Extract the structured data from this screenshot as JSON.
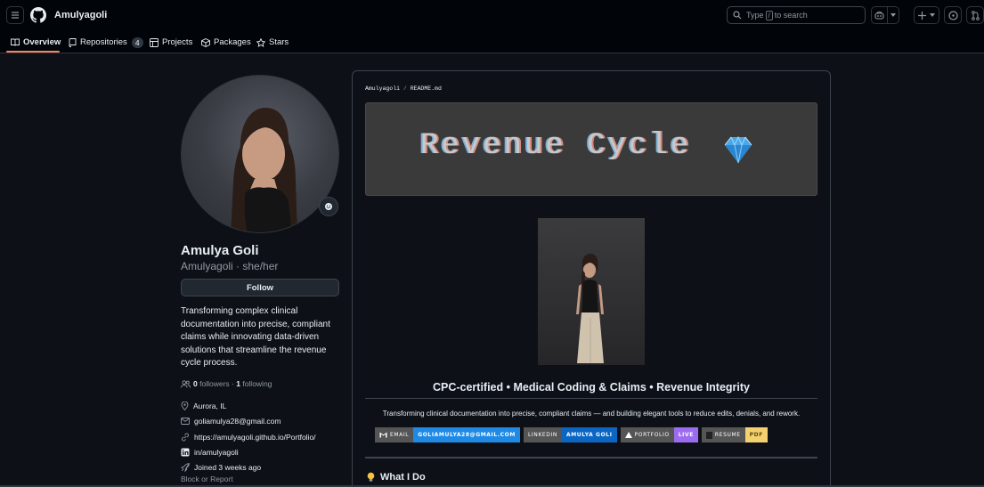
{
  "header": {
    "owner": "Amulyagoli",
    "search_prefix": "Type",
    "search_key": "/",
    "search_suffix": "to search"
  },
  "tabs": [
    {
      "label": "Overview"
    },
    {
      "label": "Repositories",
      "count": "4"
    },
    {
      "label": "Projects"
    },
    {
      "label": "Packages"
    },
    {
      "label": "Stars"
    }
  ],
  "profile": {
    "name": "Amulya Goli",
    "login_pronouns": "Amulyagoli · she/her",
    "follow_label": "Follow",
    "bio": "Transforming complex clinical documentation into precise, compliant claims while innovating data-driven solutions that streamline the revenue cycle process.",
    "followers_count": "0",
    "followers_label": "followers",
    "following_count": "1",
    "following_label": "following",
    "location": "Aurora, IL",
    "email": "goliamulya28@gmail.com",
    "website": "https://amulyagoli.github.io/Portfolio/",
    "linkedin": "in/amulyagoli",
    "joined": "Joined 3 weeks ago",
    "block_report": "Block or Report"
  },
  "readme": {
    "crumb_owner": "Amulyagoli",
    "crumb_file": "README.md",
    "banner_text": "Revenue Cycle",
    "heading": "CPC-certified • Medical Coding & Claims • Revenue Integrity",
    "tagline": "Transforming clinical documentation into precise, compliant claims — and building elegant tools to reduce edits, denials, and rework.",
    "badges": [
      {
        "key": "EMAIL",
        "value": "GOLIAMULYA28@GMAIL.COM",
        "color": "#1f8ae6"
      },
      {
        "key": "LINKEDIN",
        "value": "AMULYA GOLI",
        "color": "#0a66c2"
      },
      {
        "key": "PORTFOLIO",
        "value": "LIVE",
        "color": "#9b6cf0"
      },
      {
        "key": "RESUME",
        "value": "PDF",
        "color": "#f4d06f"
      }
    ],
    "section_heading": "What I Do"
  },
  "colors": {
    "accent_underline": "#f78166",
    "background": "#0d1117"
  }
}
